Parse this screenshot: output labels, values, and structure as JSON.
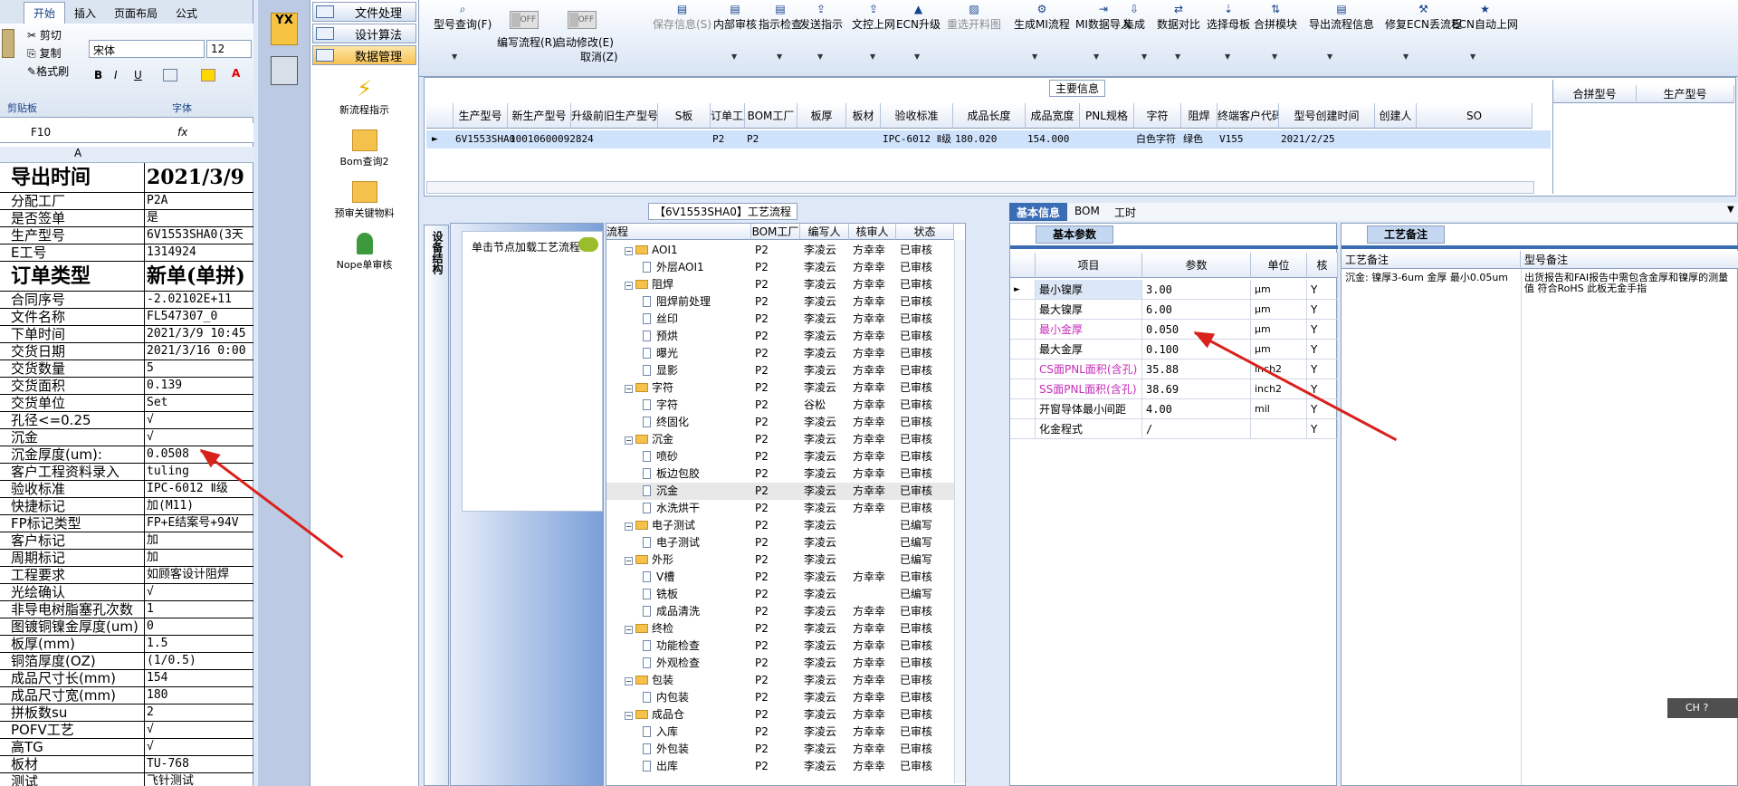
{
  "excel": {
    "tabs": [
      "开始",
      "插入",
      "页面布局",
      "公式"
    ],
    "ribbon": {
      "cut": "剪切",
      "copy": "复制",
      "format_painter": "格式刷",
      "clipboard": "剪贴板",
      "font": "字体",
      "font_name": "宋体",
      "font_size": "12",
      "bold": "B",
      "italic": "I",
      "underline": "U",
      "font_color": "A"
    },
    "name_box": "F10",
    "fx": "fx",
    "col_a": "A",
    "rows": [
      {
        "a": "导出时间",
        "b": "2021/3/9",
        "big": true
      },
      {
        "a": "分配工厂",
        "b": "P2A"
      },
      {
        "a": "是否签单",
        "b": "是"
      },
      {
        "a": "生产型号",
        "b": "6V1553SHA0(3天"
      },
      {
        "a": "E工号",
        "b": "1314924"
      },
      {
        "a": "订单类型",
        "b": "新单(单拼)",
        "big": true
      },
      {
        "a": "合同序号",
        "b": "-2.02102E+11"
      },
      {
        "a": "文件名称",
        "b": "FL547307_0"
      },
      {
        "a": "下单时间",
        "b": "2021/3/9 10:45"
      },
      {
        "a": "交货日期",
        "b": "2021/3/16 0:00"
      },
      {
        "a": "交货数量",
        "b": "5"
      },
      {
        "a": "交货面积",
        "b": "0.139"
      },
      {
        "a": "交货单位",
        "b": "Set"
      },
      {
        "a": "孔径<=0.25",
        "b": "√"
      },
      {
        "a": "沉金",
        "b": "√"
      },
      {
        "a": "沉金厚度(um):",
        "b": "0.0508"
      },
      {
        "a": "客户工程资料录入",
        "b": "tuling"
      },
      {
        "a": "验收标准",
        "b": "IPC-6012 Ⅱ级"
      },
      {
        "a": "快捷标记",
        "b": "加(M11)"
      },
      {
        "a": "FP标记类型",
        "b": "FP+E结案号+94V"
      },
      {
        "a": "客户标记",
        "b": "加"
      },
      {
        "a": "周期标记",
        "b": "加"
      },
      {
        "a": "工程要求",
        "b": "如顾客设计阻焊"
      },
      {
        "a": "光绘确认",
        "b": "√"
      },
      {
        "a": "非导电树脂塞孔次数",
        "b": "1"
      },
      {
        "a": "图镀铜镍金厚度(um)",
        "b": "0"
      },
      {
        "a": "板厚(mm)",
        "b": "1.5"
      },
      {
        "a": "铜箔厚度(OZ)",
        "b": "(1/0.5)"
      },
      {
        "a": "成品尺寸长(mm)",
        "b": "154"
      },
      {
        "a": "成品尺寸宽(mm)",
        "b": "180"
      },
      {
        "a": "拼板数su",
        "b": "2"
      },
      {
        "a": "POFV工艺",
        "b": "√"
      },
      {
        "a": "高TG",
        "b": "√"
      },
      {
        "a": "板材",
        "b": "TU-768"
      },
      {
        "a": "测试",
        "b": "飞针测试"
      }
    ]
  },
  "nav": {
    "logo": "YX",
    "items": [
      "文件处理",
      "设计算法",
      "数据管理"
    ],
    "tools": [
      "新流程指示",
      "Bom查询2",
      "预审关键物料",
      "Nope单审核"
    ]
  },
  "toolbar": {
    "items": [
      "型号查询(F)",
      "编写流程(R)",
      "启动修改(E)",
      "保存信息(S)",
      "内部审核",
      "指示检查",
      "发送指示",
      "文控上网",
      "ECN升级",
      "重选开料图",
      "生成MI流程",
      "MI数据导入",
      "集成",
      "数据对比",
      "选择母板",
      "合拼模块",
      "导出流程信息",
      "修复ECN丢流程",
      "ECN自动上网"
    ],
    "cancel": "取消(Z)",
    "off": "OFF"
  },
  "main_info": {
    "legend": "主要信息",
    "columns": [
      "生产型号",
      "新生产型号",
      "升级前旧生产型号",
      "S板",
      "订单工厂",
      "BOM工厂",
      "板厚",
      "板材",
      "验收标准",
      "成品长度",
      "成品宽度",
      "PNL规格",
      "字符",
      "阻焊",
      "终端客户代码",
      "型号创建时间",
      "创建人",
      "SO"
    ],
    "row": [
      "6V1553SHA0",
      "10010600092824",
      "",
      "",
      "P2",
      "P2",
      "",
      "",
      "IPC-6012 Ⅱ级",
      "180.020",
      "154.000",
      "",
      "白色字符",
      "绿色",
      "V155",
      "2021/2/25",
      "",
      ""
    ],
    "right_columns": [
      "合拼型号",
      "生产型号"
    ]
  },
  "process": {
    "title": "【6V1553SHA0】工艺流程",
    "side_tab": "设备结构",
    "hint": "单击节点加载工艺流程",
    "columns": [
      "流程",
      "BOM工厂",
      "编写人",
      "核审人",
      "状态"
    ],
    "rows": [
      {
        "n": "AOI1",
        "l": 0,
        "f": "P2",
        "w": "李凌云",
        "r": "方幸幸",
        "s": "已审核"
      },
      {
        "n": "外层AOI1",
        "l": 1,
        "f": "P2",
        "w": "李凌云",
        "r": "方幸幸",
        "s": "已审核"
      },
      {
        "n": "阻焊",
        "l": 0,
        "f": "P2",
        "w": "李凌云",
        "r": "方幸幸",
        "s": "已审核"
      },
      {
        "n": "阻焊前处理",
        "l": 1,
        "f": "P2",
        "w": "李凌云",
        "r": "方幸幸",
        "s": "已审核"
      },
      {
        "n": "丝印",
        "l": 1,
        "f": "P2",
        "w": "李凌云",
        "r": "方幸幸",
        "s": "已审核"
      },
      {
        "n": "预烘",
        "l": 1,
        "f": "P2",
        "w": "李凌云",
        "r": "方幸幸",
        "s": "已审核"
      },
      {
        "n": "曝光",
        "l": 1,
        "f": "P2",
        "w": "李凌云",
        "r": "方幸幸",
        "s": "已审核"
      },
      {
        "n": "显影",
        "l": 1,
        "f": "P2",
        "w": "李凌云",
        "r": "方幸幸",
        "s": "已审核"
      },
      {
        "n": "字符",
        "l": 0,
        "f": "P2",
        "w": "李凌云",
        "r": "方幸幸",
        "s": "已审核"
      },
      {
        "n": "字符",
        "l": 1,
        "f": "P2",
        "w": "谷松",
        "r": "方幸幸",
        "s": "已审核"
      },
      {
        "n": "终固化",
        "l": 1,
        "f": "P2",
        "w": "李凌云",
        "r": "方幸幸",
        "s": "已审核"
      },
      {
        "n": "沉金",
        "l": 0,
        "f": "P2",
        "w": "李凌云",
        "r": "方幸幸",
        "s": "已审核"
      },
      {
        "n": "喷砂",
        "l": 1,
        "f": "P2",
        "w": "李凌云",
        "r": "方幸幸",
        "s": "已审核"
      },
      {
        "n": "板边包胶",
        "l": 1,
        "f": "P2",
        "w": "李凌云",
        "r": "方幸幸",
        "s": "已审核"
      },
      {
        "n": "沉金",
        "l": 1,
        "f": "P2",
        "w": "李凌云",
        "r": "方幸幸",
        "s": "已审核",
        "sel": true
      },
      {
        "n": "水洗烘干",
        "l": 1,
        "f": "P2",
        "w": "李凌云",
        "r": "方幸幸",
        "s": "已审核"
      },
      {
        "n": "电子测试",
        "l": 0,
        "f": "P2",
        "w": "李凌云",
        "r": "",
        "s": "已编写"
      },
      {
        "n": "电子测试",
        "l": 1,
        "f": "P2",
        "w": "李凌云",
        "r": "",
        "s": "已编写"
      },
      {
        "n": "外形",
        "l": 0,
        "f": "P2",
        "w": "李凌云",
        "r": "",
        "s": "已编写"
      },
      {
        "n": "V槽",
        "l": 1,
        "f": "P2",
        "w": "李凌云",
        "r": "方幸幸",
        "s": "已审核"
      },
      {
        "n": "铣板",
        "l": 1,
        "f": "P2",
        "w": "李凌云",
        "r": "",
        "s": "已编写"
      },
      {
        "n": "成品清洗",
        "l": 1,
        "f": "P2",
        "w": "李凌云",
        "r": "方幸幸",
        "s": "已审核"
      },
      {
        "n": "终检",
        "l": 0,
        "f": "P2",
        "w": "李凌云",
        "r": "方幸幸",
        "s": "已审核"
      },
      {
        "n": "功能检查",
        "l": 1,
        "f": "P2",
        "w": "李凌云",
        "r": "方幸幸",
        "s": "已审核"
      },
      {
        "n": "外观检查",
        "l": 1,
        "f": "P2",
        "w": "李凌云",
        "r": "方幸幸",
        "s": "已审核"
      },
      {
        "n": "包装",
        "l": 0,
        "f": "P2",
        "w": "李凌云",
        "r": "方幸幸",
        "s": "已审核"
      },
      {
        "n": "内包装",
        "l": 1,
        "f": "P2",
        "w": "李凌云",
        "r": "方幸幸",
        "s": "已审核"
      },
      {
        "n": "成品仓",
        "l": 0,
        "f": "P2",
        "w": "李凌云",
        "r": "方幸幸",
        "s": "已审核"
      },
      {
        "n": "入库",
        "l": 1,
        "f": "P2",
        "w": "李凌云",
        "r": "方幸幸",
        "s": "已审核"
      },
      {
        "n": "外包装",
        "l": 1,
        "f": "P2",
        "w": "李凌云",
        "r": "方幸幸",
        "s": "已审核"
      },
      {
        "n": "出库",
        "l": 1,
        "f": "P2",
        "w": "李凌云",
        "r": "方幸幸",
        "s": "已审核"
      }
    ]
  },
  "params": {
    "tabs": [
      "基本信息",
      "BOM",
      "工时"
    ],
    "sub_tab": "基本参数",
    "columns": [
      "项目",
      "参数",
      "单位",
      "核"
    ],
    "rows": [
      {
        "item": "最小镍厚",
        "val": "3.00",
        "unit": "μm",
        "k": "Y",
        "hl": false,
        "cur": true
      },
      {
        "item": "最大镍厚",
        "val": "6.00",
        "unit": "μm",
        "k": "Y",
        "hl": false
      },
      {
        "item": "最小金厚",
        "val": "0.050",
        "unit": "μm",
        "k": "Y",
        "hl": true
      },
      {
        "item": "最大金厚",
        "val": "0.100",
        "unit": "μm",
        "k": "Y",
        "hl": false
      },
      {
        "item": "CS面PNL面积(含孔)",
        "val": "35.88",
        "unit": "inch2",
        "k": "Y",
        "hl": true
      },
      {
        "item": "SS面PNL面积(含孔)",
        "val": "38.69",
        "unit": "inch2",
        "k": "Y",
        "hl": true
      },
      {
        "item": "开窗导体最小间距",
        "val": "4.00",
        "unit": "mil",
        "k": "Y",
        "hl": false
      },
      {
        "item": "化金程式",
        "val": "/",
        "unit": "",
        "k": "Y",
        "hl": false
      }
    ]
  },
  "remarks": {
    "tab": "工艺备注",
    "col1": "工艺备注",
    "col2": "型号备注",
    "text1": "沉金: 镍厚3-6um 金厚 最小0.05um",
    "text2": "出货报告和FAI报告中需包含金厚和镍厚的测量值 符合RoHS 此板无金手指"
  },
  "ime": "CH"
}
